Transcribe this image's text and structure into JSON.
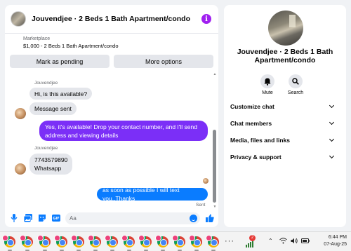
{
  "chat": {
    "title": "Jouvendjee · 2 Beds 1 Bath Apartment/condo",
    "listing_label": "Marketplace",
    "listing_detail": "$1,000 - 2 Beds 1 Bath Apartment/condo",
    "mark_pending_label": "Mark as pending",
    "more_options_label": "More options",
    "messages": [
      {
        "sender": "Jouvendjee",
        "text": "Hi, is this available?",
        "direction": "in"
      },
      {
        "text": "Message sent",
        "direction": "in"
      },
      {
        "text": "Yes, it's available! Drop your contact number, and I'll send address and viewing details",
        "direction": "out",
        "color": "#7b2ff7"
      },
      {
        "sender": "Jouvendjee",
        "text": "7743579890",
        "direction": "in"
      },
      {
        "text": "Whatsapp",
        "direction": "in"
      },
      {
        "text": "as soon as possible I will text you..Thanks",
        "direction": "out",
        "color": "#0a7cff"
      }
    ],
    "sent_label": "Sent",
    "composer_placeholder": "Aa",
    "accent_color": "#0a7cff"
  },
  "info": {
    "title": "Jouvendjee · 2 Beds 1 Bath Apartment/condo",
    "mute_label": "Mute",
    "search_label": "Search",
    "menu": [
      "Customize chat",
      "Chat members",
      "Media, files and links",
      "Privacy & support"
    ]
  },
  "taskbar": {
    "tray_badge": "2",
    "time": "6:44 PM",
    "date": "07-Aug-25"
  }
}
